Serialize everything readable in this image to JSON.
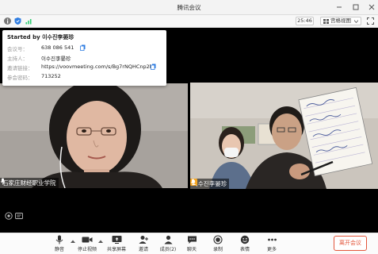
{
  "window": {
    "title": "腾讯会议"
  },
  "toolbar": {
    "time": "25:46",
    "view_label": "宫格视图"
  },
  "info": {
    "started_by": "Started by 이수진李晏珍",
    "rows": [
      {
        "key": "会议号：",
        "value": "638 086 541"
      },
      {
        "key": "主持人：",
        "value": "이수진李晏珍"
      },
      {
        "key": "邀请链接：",
        "value": "https://voovmeeting.com/s/Bg7rNQHCnp2k"
      },
      {
        "key": "参会密码：",
        "value": "713252"
      }
    ]
  },
  "participants": [
    {
      "name": "石家庄财经职业学院"
    },
    {
      "name": "이수진李晏珍"
    }
  ],
  "bottom": {
    "mute": "静音",
    "video": "停止视频",
    "share": "共享屏幕",
    "invite": "邀请",
    "members": "成员(2)",
    "chat": "聊天",
    "record": "录制",
    "reaction": "表情",
    "more": "更多",
    "leave": "离开会议"
  },
  "colors": {
    "accent": "#2f7de1",
    "active_speaker": "#2ecc71",
    "leave": "#e3563b"
  }
}
